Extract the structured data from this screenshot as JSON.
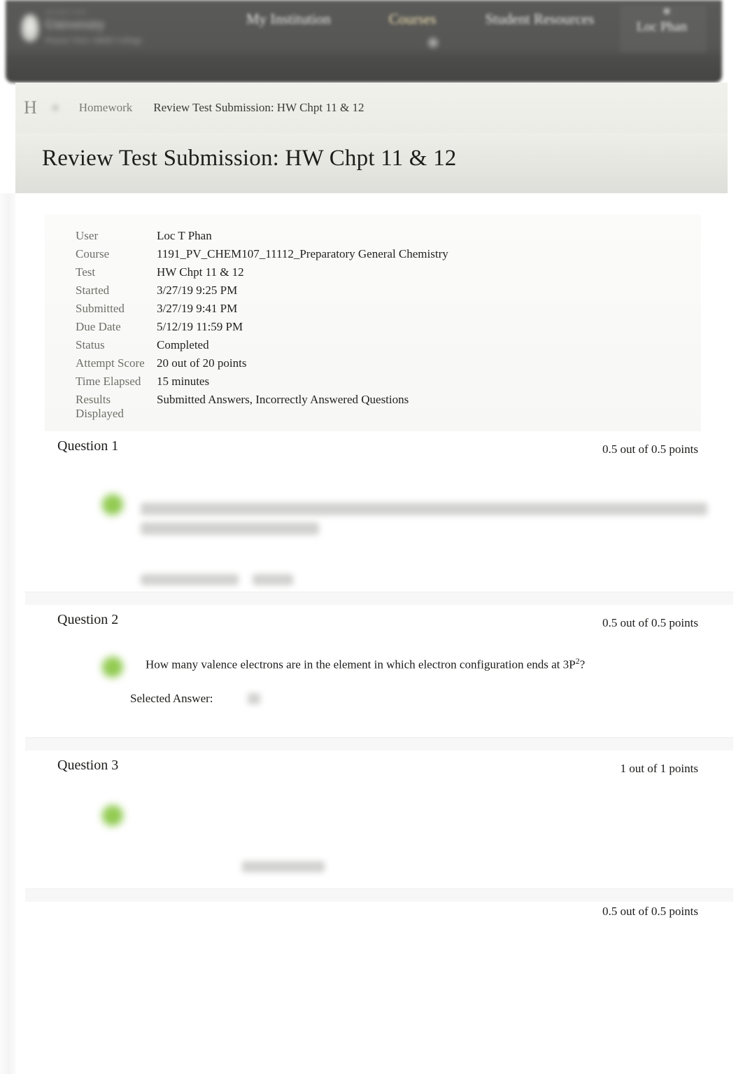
{
  "header": {
    "logo_line1": "University",
    "logo_line2": "Prairie View A&M College",
    "logo_tiny": "PRAIRIE VIEW",
    "nav": [
      {
        "label": "My Institution",
        "active": false
      },
      {
        "label": "Courses",
        "active": true
      },
      {
        "label": "Student Resources",
        "active": false
      }
    ],
    "user_name": "Loc Phan"
  },
  "breadcrumb": {
    "home": "H",
    "items": [
      "Homework",
      "Review Test Submission: HW Chpt 11 & 12"
    ]
  },
  "page": {
    "title": "Review Test Submission: HW Chpt 11 & 12"
  },
  "summary": {
    "rows": [
      {
        "label": "User",
        "value": "Loc T Phan"
      },
      {
        "label": "Course",
        "value": "1191_PV_CHEM107_11112_Preparatory General Chemistry"
      },
      {
        "label": "Test",
        "value": "HW Chpt 11 & 12"
      },
      {
        "label": "Started",
        "value": "3/27/19 9:25 PM"
      },
      {
        "label": "Submitted",
        "value": "3/27/19 9:41 PM"
      },
      {
        "label": "Due Date",
        "value": "5/12/19 11:59 PM"
      },
      {
        "label": "Status",
        "value": "Completed"
      },
      {
        "label": "Attempt Score",
        "value": "20 out of 20 points"
      },
      {
        "label": "Time Elapsed",
        "value": "15 minutes"
      },
      {
        "label": "Results Displayed",
        "value": "Submitted Answers, Incorrectly Answered Questions"
      }
    ]
  },
  "questions": [
    {
      "label": "Question 1",
      "points": "0.5 out of 0.5 points",
      "text": "",
      "answer_label": "Selected Answer:",
      "answer_value": ""
    },
    {
      "label": "Question 2",
      "points": "0.5 out of 0.5 points",
      "text": "How many valence electrons are in the element in which electron configuration ends at 3P",
      "text_superscript": "2",
      "text_tail": "?",
      "answer_label": "Selected Answer:",
      "answer_value": ""
    },
    {
      "label": "Question 3",
      "points": "1 out of 1 points",
      "text": "",
      "answer_label": "",
      "answer_value": ""
    },
    {
      "label": "",
      "points": "0.5 out of 0.5 points",
      "text": "",
      "answer_label": "",
      "answer_value": ""
    }
  ],
  "colors": {
    "nav_bar": "#565654",
    "nav_active_text": "#f3e3b4",
    "correct_indicator": "#86c544",
    "breadcrumb_band": "#ecece6",
    "title_band": "#e6e6e0"
  }
}
